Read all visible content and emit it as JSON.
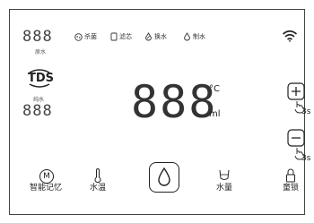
{
  "left_panel": {
    "raw_water_value": "888",
    "raw_water_label": "原水",
    "tds_label": "TDS",
    "pure_water_label": "纯水",
    "pure_water_value": "888"
  },
  "status_bar": {
    "items": [
      {
        "label": "杀菌",
        "icon": "sterilize-icon"
      },
      {
        "label": "滤芯",
        "icon": "filter-icon"
      },
      {
        "label": "换水",
        "icon": "change-water-icon"
      },
      {
        "label": "制水",
        "icon": "make-water-icon"
      }
    ],
    "wifi_icon": "wifi-icon"
  },
  "center_display": {
    "value": "888",
    "temp_unit": "°C",
    "volume_unit": "ml"
  },
  "right_controls": {
    "plus_icon": "plus-icon",
    "minus_icon": "minus-icon",
    "plus_hold": "3s",
    "minus_hold": "3s"
  },
  "bottom_controls": {
    "memory_icon": "M",
    "memory_label": "智能记忆",
    "water_temp_label": "水温",
    "dispense_icon": "water-drop-icon",
    "water_volume_label": "水量",
    "child_lock_label": "童锁"
  }
}
